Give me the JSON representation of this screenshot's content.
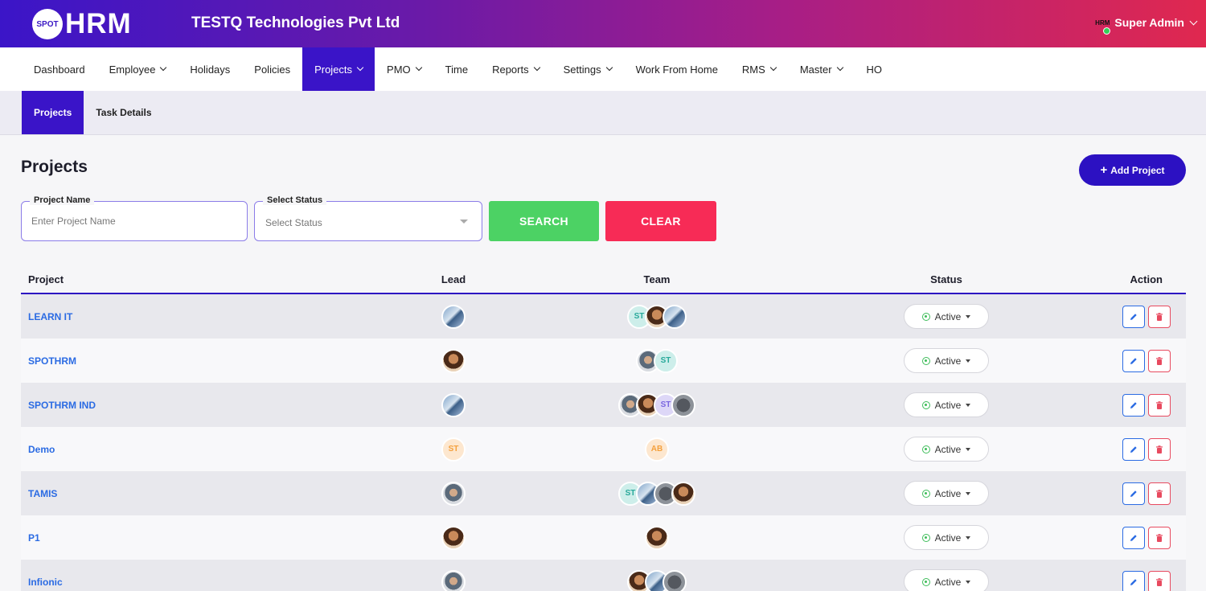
{
  "header": {
    "logo_badge": "SPOT",
    "logo_text": "HRM",
    "company": "TESTQ Technologies Pvt Ltd",
    "user_logo": "HRM",
    "user_name": "Super Admin"
  },
  "nav": {
    "items": [
      {
        "label": "Dashboard",
        "dropdown": false
      },
      {
        "label": "Employee",
        "dropdown": true
      },
      {
        "label": "Holidays",
        "dropdown": false
      },
      {
        "label": "Policies",
        "dropdown": false
      },
      {
        "label": "Projects",
        "dropdown": true,
        "active": true
      },
      {
        "label": "PMO",
        "dropdown": true
      },
      {
        "label": "Time",
        "dropdown": false
      },
      {
        "label": "Reports",
        "dropdown": true
      },
      {
        "label": "Settings",
        "dropdown": true
      },
      {
        "label": "Work From Home",
        "dropdown": false
      },
      {
        "label": "RMS",
        "dropdown": true
      },
      {
        "label": "Master",
        "dropdown": true
      },
      {
        "label": "HO",
        "dropdown": false
      }
    ]
  },
  "subnav": {
    "items": [
      {
        "label": "Projects",
        "active": true
      },
      {
        "label": "Task Details",
        "active": false
      }
    ]
  },
  "page": {
    "title": "Projects",
    "add_button": "Add Project",
    "add_button_icon": "+"
  },
  "filters": {
    "project_name_label": "Project Name",
    "project_name_placeholder": "Enter Project Name",
    "status_label": "Select Status",
    "status_value": "Select Status",
    "search_button": "SEARCH",
    "clear_button": "CLEAR"
  },
  "table": {
    "headers": {
      "project": "Project",
      "lead": "Lead",
      "team": "Team",
      "status": "Status",
      "action": "Action"
    },
    "status_label": "Active",
    "rows": [
      {
        "project": "LEARN IT",
        "lead": [
          {
            "type": "photo2"
          }
        ],
        "team": [
          {
            "type": "st-teal",
            "text": "ST"
          },
          {
            "type": "photo1"
          },
          {
            "type": "photo2"
          }
        ]
      },
      {
        "project": "SPOTHRM",
        "lead": [
          {
            "type": "photo1"
          }
        ],
        "team": [
          {
            "type": "photo3"
          },
          {
            "type": "st-teal",
            "text": "ST"
          }
        ]
      },
      {
        "project": "SPOTHRM IND",
        "lead": [
          {
            "type": "photo2"
          }
        ],
        "team": [
          {
            "type": "photo3"
          },
          {
            "type": "photo1"
          },
          {
            "type": "st-purple",
            "text": "ST"
          },
          {
            "type": "photo4"
          }
        ]
      },
      {
        "project": "Demo",
        "lead": [
          {
            "type": "st-orange",
            "text": "ST"
          }
        ],
        "team": [
          {
            "type": "ab",
            "text": "AB"
          }
        ]
      },
      {
        "project": "TAMIS",
        "lead": [
          {
            "type": "photo3"
          }
        ],
        "team": [
          {
            "type": "st-teal",
            "text": "ST"
          },
          {
            "type": "photo2"
          },
          {
            "type": "photo4"
          },
          {
            "type": "photo1"
          }
        ]
      },
      {
        "project": "P1",
        "lead": [
          {
            "type": "photo1"
          }
        ],
        "team": [
          {
            "type": "photo1"
          }
        ]
      },
      {
        "project": "Infionic",
        "lead": [
          {
            "type": "photo3"
          }
        ],
        "team": [
          {
            "type": "photo1"
          },
          {
            "type": "photo2"
          },
          {
            "type": "photo4"
          }
        ]
      }
    ]
  },
  "colors": {
    "primary": "#2c11c2",
    "search": "#4cd264",
    "clear": "#f72b56",
    "link": "#2b6be3",
    "active_status": "#3ebd5a"
  }
}
